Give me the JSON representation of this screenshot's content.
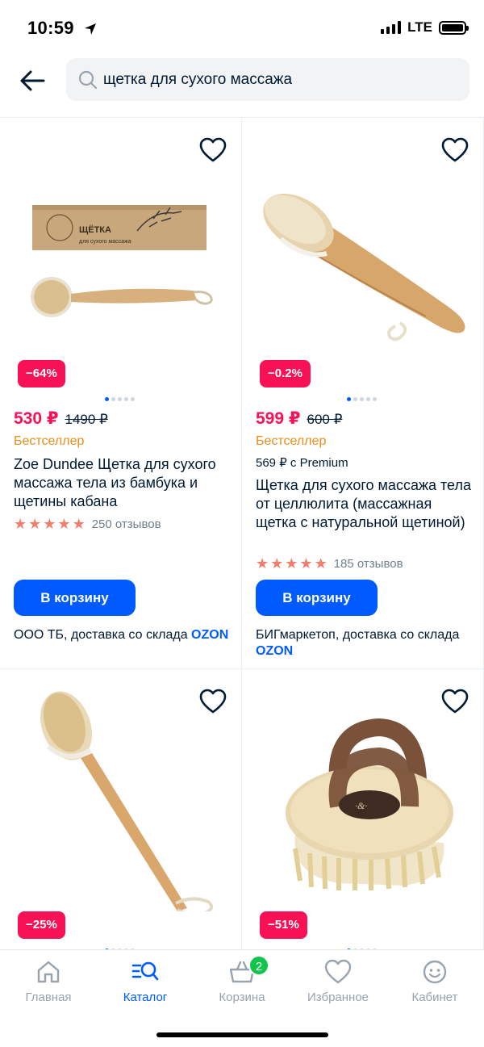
{
  "status": {
    "time": "10:59",
    "network": "LTE"
  },
  "search": {
    "query": "щетка для сухого массажа"
  },
  "products": [
    {
      "discount": "−64%",
      "price": "530 ₽",
      "old_price": "1490 ₽",
      "badge": "Бестселлер",
      "premium_price": "",
      "title": "Zoe Dundee Щетка для сухого массажа тела  из бамбука и щетины кабана",
      "stars": 5,
      "reviews": "250 отзывов",
      "cart_label": "В корзину",
      "seller": "ООО ТБ, доставка со склада",
      "ozon": "OZON",
      "box_text": "ЩЁТКА",
      "box_subtext": "для сухого массажа"
    },
    {
      "discount": "−0.2%",
      "price": "599 ₽",
      "old_price": "600 ₽",
      "badge": "Бестселлер",
      "premium_price": "569 ₽ с Premium",
      "title": "Щетка для сухого массажа тела от целлюлита (массажная щетка с натуральной щетиной)",
      "stars": 5,
      "reviews": "185 отзывов",
      "cart_label": "В корзину",
      "seller": "БИГмаркетоп, доставка со склада",
      "ozon": "OZON"
    },
    {
      "discount": "−25%"
    },
    {
      "discount": "−51%"
    }
  ],
  "tabs": [
    {
      "label": "Главная",
      "icon": "home-icon"
    },
    {
      "label": "Каталог",
      "icon": "catalog-search-icon",
      "active": true
    },
    {
      "label": "Корзина",
      "icon": "basket-icon",
      "badge": "2"
    },
    {
      "label": "Избранное",
      "icon": "heart-icon"
    },
    {
      "label": "Кабинет",
      "icon": "smiley-icon"
    }
  ],
  "colors": {
    "accent": "#005bff",
    "sale": "#f91155",
    "bestseller": "#e88d17",
    "badge_green": "#10c44c",
    "star": "#f47c6a"
  }
}
